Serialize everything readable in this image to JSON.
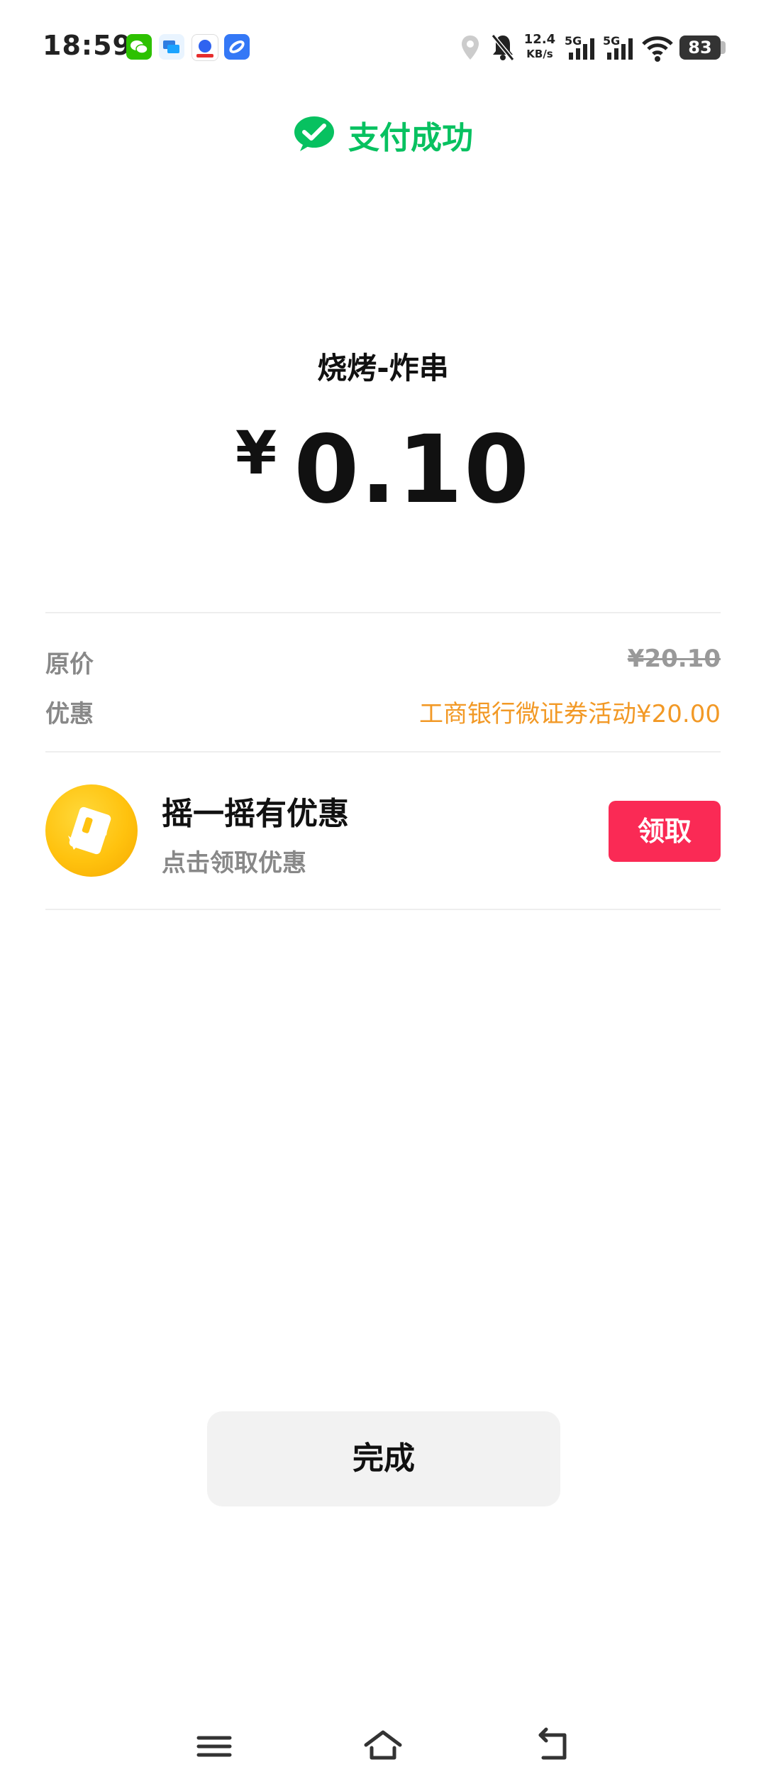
{
  "status_bar": {
    "time": "18:59",
    "app_icons": [
      "wechat-icon",
      "message-icon",
      "baidu-icon",
      "browser-icon"
    ],
    "net_speed_value": "12.4",
    "net_speed_unit": "KB/s",
    "signal_1_label": "5G",
    "signal_2_label": "5G",
    "battery": "83"
  },
  "header": {
    "title": "支付成功",
    "accent_color": "#07c160"
  },
  "payment": {
    "merchant": "烧烤-炸串",
    "currency": "¥",
    "amount": "0.10"
  },
  "details": {
    "original_label": "原价",
    "original_value": "¥20.10",
    "discount_label": "优惠",
    "discount_value": "工商银行微证券活动¥20.00",
    "discount_color": "#f29926"
  },
  "promo": {
    "title": "摇一摇有优惠",
    "subtitle": "点击领取优惠",
    "button_label": "领取",
    "button_color": "#fa2a55"
  },
  "actions": {
    "done_label": "完成"
  },
  "nav_bar": {
    "buttons": [
      "menu-icon",
      "home-icon",
      "back-icon"
    ]
  }
}
